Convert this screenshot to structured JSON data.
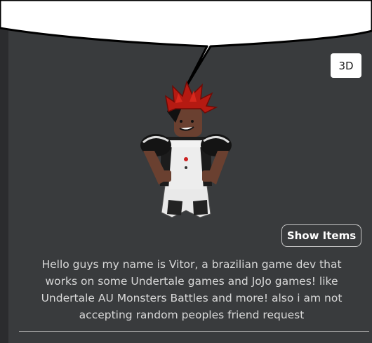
{
  "profile": {
    "view_3d_label": "3D",
    "show_items_label": "Show Items",
    "bio": "Hello guys my name is Vitor, a brazilian game dev that\nworks on some Undertale games and JoJo games! like\nUndertale AU Monsters Battles and more! also i am not\naccepting random peoples friend request"
  },
  "colors": {
    "panel_bg": "#393b3d",
    "bubble": "#ffffff",
    "text": "#d9d9d9"
  },
  "icons": {
    "avatar": "roblox-avatar-red-spiky-hair-maid-outfit"
  }
}
